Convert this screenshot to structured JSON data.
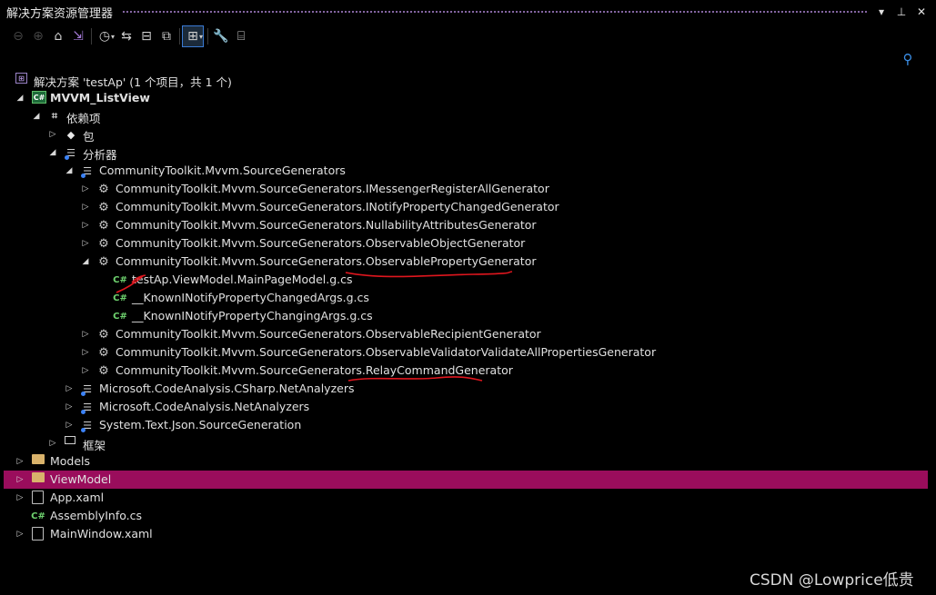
{
  "window": {
    "title": "解决方案资源管理器",
    "controls": [
      "chevron-down-icon",
      "pin-icon",
      "close-icon"
    ]
  },
  "toolbar": {
    "buttons": [
      {
        "name": "back-icon",
        "glyph": "←"
      },
      {
        "name": "forward-icon",
        "glyph": "→"
      },
      {
        "name": "home-icon",
        "glyph": "⌂"
      },
      {
        "name": "vs-switch-views-icon",
        "glyph": "⧉"
      },
      {
        "name": "history-icon",
        "glyph": "◷"
      },
      {
        "name": "sync-icon",
        "glyph": "⇆"
      },
      {
        "name": "collapse-all-icon",
        "glyph": "⊟"
      },
      {
        "name": "show-all-files-icon",
        "glyph": "⧉"
      },
      {
        "name": "pending-changes-filter-icon",
        "glyph": "⊞"
      },
      {
        "name": "properties-wrench-icon",
        "glyph": "🔧"
      },
      {
        "name": "preview-icon",
        "glyph": "⌸"
      }
    ]
  },
  "search": {
    "icon": "search-icon",
    "glyph": "⚲"
  },
  "tree": {
    "rows": [
      {
        "label": "解决方案 'testAp' (1 个项目，共 1 个)",
        "icon": "solution-icon",
        "expander": ""
      },
      {
        "label": "MVVM_ListView",
        "icon": "csharp-project-icon",
        "expander": "expanded",
        "bold": true
      },
      {
        "label": "依赖项",
        "icon": "dependencies-icon",
        "expander": "expanded"
      },
      {
        "label": "包",
        "icon": "package-icon",
        "expander": "collapsed"
      },
      {
        "label": "分析器",
        "icon": "analyzer-icon",
        "expander": "expanded"
      },
      {
        "label": "CommunityToolkit.Mvvm.SourceGenerators",
        "icon": "analyzer-icon",
        "expander": "expanded"
      },
      {
        "label": "CommunityToolkit.Mvvm.SourceGenerators.IMessengerRegisterAllGenerator",
        "icon": "generator-gear-icon",
        "expander": "collapsed"
      },
      {
        "label": "CommunityToolkit.Mvvm.SourceGenerators.INotifyPropertyChangedGenerator",
        "icon": "generator-gear-icon",
        "expander": "collapsed"
      },
      {
        "label": "CommunityToolkit.Mvvm.SourceGenerators.NullabilityAttributesGenerator",
        "icon": "generator-gear-icon",
        "expander": "collapsed"
      },
      {
        "label": "CommunityToolkit.Mvvm.SourceGenerators.ObservableObjectGenerator",
        "icon": "generator-gear-icon",
        "expander": "collapsed"
      },
      {
        "label": "CommunityToolkit.Mvvm.SourceGenerators.ObservablePropertyGenerator",
        "icon": "generator-gear-icon",
        "expander": "expanded"
      },
      {
        "label": "testAp.ViewModel.MainPageModel.g.cs",
        "icon": "csharp-file-icon",
        "expander": ""
      },
      {
        "label": "__KnownINotifyPropertyChangedArgs.g.cs",
        "icon": "csharp-file-icon",
        "expander": ""
      },
      {
        "label": "__KnownINotifyPropertyChangingArgs.g.cs",
        "icon": "csharp-file-icon",
        "expander": ""
      },
      {
        "label": "CommunityToolkit.Mvvm.SourceGenerators.ObservableRecipientGenerator",
        "icon": "generator-gear-icon",
        "expander": "collapsed"
      },
      {
        "label": "CommunityToolkit.Mvvm.SourceGenerators.ObservableValidatorValidateAllPropertiesGenerator",
        "icon": "generator-gear-icon",
        "expander": "collapsed"
      },
      {
        "label": "CommunityToolkit.Mvvm.SourceGenerators.RelayCommandGenerator",
        "icon": "generator-gear-icon",
        "expander": "collapsed"
      },
      {
        "label": "Microsoft.CodeAnalysis.CSharp.NetAnalyzers",
        "icon": "analyzer-icon",
        "expander": "collapsed"
      },
      {
        "label": "Microsoft.CodeAnalysis.NetAnalyzers",
        "icon": "analyzer-icon",
        "expander": "collapsed"
      },
      {
        "label": "System.Text.Json.SourceGeneration",
        "icon": "analyzer-icon",
        "expander": "collapsed"
      },
      {
        "label": "框架",
        "icon": "framework-icon",
        "expander": "collapsed"
      },
      {
        "label": "Models",
        "icon": "folder-icon",
        "expander": "collapsed"
      },
      {
        "label": "ViewModel",
        "icon": "folder-icon",
        "expander": "collapsed",
        "selected": true
      },
      {
        "label": "App.xaml",
        "icon": "xaml-file-icon",
        "expander": "collapsed"
      },
      {
        "label": "AssemblyInfo.cs",
        "icon": "csharp-file-icon",
        "expander": ""
      },
      {
        "label": "MainWindow.xaml",
        "icon": "xaml-file-icon",
        "expander": "collapsed"
      }
    ]
  },
  "watermark": "CSDN @Lowprice低贵",
  "colors": {
    "background": "#000000",
    "selection": "#9a0d5c",
    "annotation_red": "#e0161e",
    "csharp_green": "#6fd36f"
  }
}
